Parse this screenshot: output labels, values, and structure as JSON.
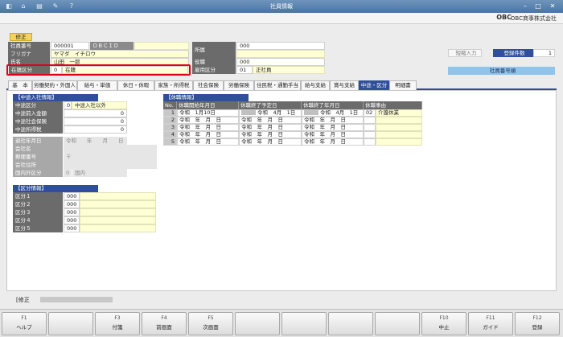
{
  "window": {
    "title": "社員情報"
  },
  "company": {
    "brand": "OBC",
    "name": "OBC商事株式会社"
  },
  "mode": "修正",
  "employee": {
    "no_label": "社員番号",
    "no": "000001",
    "obcid_label": "ＯＢＣＩＤ",
    "kana_label": "フリガナ",
    "kana": "ヤマダ　イチロウ",
    "name_label": "氏名",
    "name": "山田　一郎",
    "status_label": "在籍区分",
    "status_code": "0",
    "status": "在籍"
  },
  "dept": {
    "dept_label": "所属",
    "dept_code": "000",
    "post_label": "役職",
    "post_code": "000",
    "emp_label": "雇用区分",
    "emp_code": "01",
    "emp": "正社員"
  },
  "right": {
    "btn_shorten": "短縮入力",
    "count_label": "登録件数",
    "count": "1",
    "order": "社員番号順"
  },
  "tabs": [
    "基　本",
    "労働契約・外国人",
    "給与・単価",
    "休日・休暇",
    "家族・所得税",
    "社会保険",
    "労働保険",
    "住民税・通勤手当",
    "給与支給",
    "賞与支給",
    "中途・区分",
    "明細書"
  ],
  "midcareer": {
    "section": "【中途入社情報】",
    "kubun_label": "中途区分",
    "kubun_code": "0",
    "kubun": "中途入社以外",
    "pay_label": "中途前入金額",
    "pay": "0",
    "ins_label": "中途社会保険",
    "ins": "0",
    "tax_label": "中途所得税",
    "tax": "0",
    "retire_label": "退社年月日",
    "retire": "令和　　年　　月　　日",
    "corp_label": "会社名",
    "zip_label": "郵便番号",
    "zip": "〒",
    "addr_label": "会社住所",
    "abroad_label": "国内外区分",
    "abroad_code": "0",
    "abroad": "国内"
  },
  "classes": {
    "section": "【区分情報】",
    "items": [
      {
        "label": "区分１",
        "code": "000"
      },
      {
        "label": "区分２",
        "code": "000"
      },
      {
        "label": "区分３",
        "code": "000"
      },
      {
        "label": "区分４",
        "code": "000"
      },
      {
        "label": "区分５",
        "code": "000"
      }
    ]
  },
  "leave": {
    "section": "【休職情報】",
    "headers": [
      "No.",
      "休職開始年月日",
      "休職終了予定日",
      "休職終了年月日",
      "休職事由"
    ],
    "rows": [
      {
        "no": "1",
        "start": "令和　1月10日",
        "plan": "令和　4月　1日",
        "end": "令和　4月　1日",
        "code": "02",
        "reason": "介護休業"
      },
      {
        "no": "2",
        "start": "令和　年　月　日",
        "plan": "令和　年　月　日",
        "end": "令和　年　月　日",
        "code": "",
        "reason": ""
      },
      {
        "no": "3",
        "start": "令和　年　月　日",
        "plan": "令和　年　月　日",
        "end": "令和　年　月　日",
        "code": "",
        "reason": ""
      },
      {
        "no": "4",
        "start": "令和　年　月　日",
        "plan": "令和　年　月　日",
        "end": "令和　年　月　日",
        "code": "",
        "reason": ""
      },
      {
        "no": "5",
        "start": "令和　年　月　日",
        "plan": "令和　年　月　日",
        "end": "令和　年　月　日",
        "code": "",
        "reason": ""
      }
    ]
  },
  "status": {
    "text": "[修正"
  },
  "fkeys": [
    {
      "key": "F1",
      "label": "ヘルプ"
    },
    {
      "key": "",
      "label": ""
    },
    {
      "key": "F3",
      "label": "付箋"
    },
    {
      "key": "F4",
      "label": "前画面"
    },
    {
      "key": "F5",
      "label": "次画面"
    },
    {
      "key": "",
      "label": ""
    },
    {
      "key": "",
      "label": ""
    },
    {
      "key": "",
      "label": ""
    },
    {
      "key": "",
      "label": ""
    },
    {
      "key": "F10",
      "label": "中止"
    },
    {
      "key": "F11",
      "label": "ガイド"
    },
    {
      "key": "F12",
      "label": "登録"
    }
  ]
}
